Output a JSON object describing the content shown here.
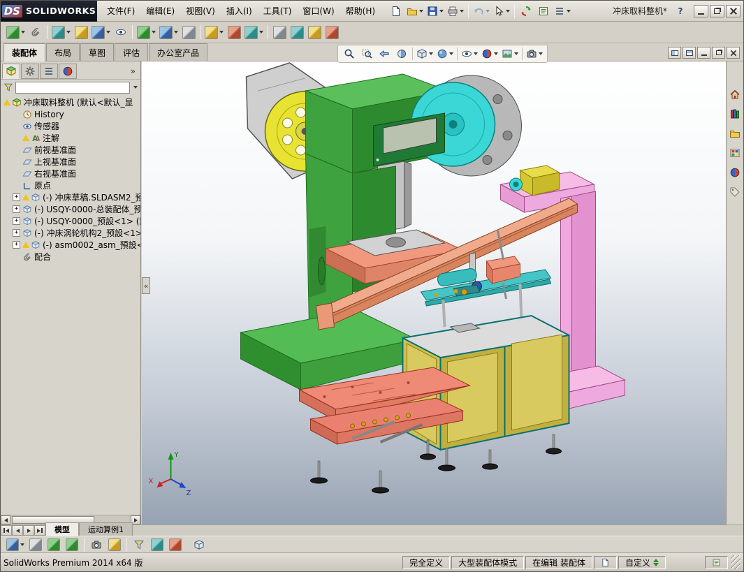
{
  "titlebar": {
    "brand_mark": "DS",
    "brand": "SOLIDWORKS",
    "doc_title": "冲床取料整机*",
    "help_label": "?",
    "menus": [
      "文件(F)",
      "编辑(E)",
      "视图(V)",
      "插入(I)",
      "工具(T)",
      "窗口(W)",
      "帮助(H)"
    ]
  },
  "toolbar_main": {
    "items": [
      "new-document",
      "open-document",
      "save-document",
      "print-document",
      "undo",
      "select-arrow",
      "rebuild",
      "file-properties",
      "options-list"
    ]
  },
  "toolbar_assembly": {
    "items": [
      "insert-components",
      "mate",
      "linear-component-pattern",
      "smart-fasteners",
      "move-component",
      "show-hidden-components",
      "assembly-features",
      "reference-geometry",
      "new-motion-study",
      "bill-of-materials",
      "exploded-view",
      "explode-line-sketch",
      "interference-detection",
      "clearance-verification",
      "hole-alignment",
      "isolate-components"
    ]
  },
  "command_tabs": {
    "items": [
      "装配体",
      "布局",
      "草图",
      "评估",
      "办公室产品"
    ],
    "active": "装配体"
  },
  "panel_tabs": {
    "items": [
      "featuremanager",
      "propertymanager",
      "configurationmanager",
      "displaymanager"
    ],
    "more_label": "»"
  },
  "feature_panel": {
    "filter_value": "",
    "collapse_label": "«",
    "tree": [
      {
        "label": "冲床取料整机 (默认<默认_显",
        "icon": "assembly",
        "warning": true
      },
      {
        "label": "History",
        "icon": "history"
      },
      {
        "label": "传感器",
        "icon": "sensors"
      },
      {
        "label": "注解",
        "icon": "annotations",
        "warning": true
      },
      {
        "label": "前视基准面",
        "icon": "plane"
      },
      {
        "label": "上视基准面",
        "icon": "plane"
      },
      {
        "label": "右视基准面",
        "icon": "plane"
      },
      {
        "label": "原点",
        "icon": "origin"
      },
      {
        "label": "(-) 冲床草稿.SLDASM2_预",
        "icon": "component",
        "warning": true,
        "expandable": true
      },
      {
        "label": "(-) USQY-0000-总装配体_预",
        "icon": "component",
        "expandable": true
      },
      {
        "label": "(-) USQY-0000_预設<1> (默",
        "icon": "component",
        "expandable": true
      },
      {
        "label": "(-) 冲床涡轮机构2_预設<1>",
        "icon": "component",
        "expandable": true
      },
      {
        "label": "(-) asm0002_asm_預設<1",
        "icon": "component",
        "warning": true,
        "expandable": true
      },
      {
        "label": "配合",
        "icon": "mates"
      }
    ]
  },
  "headsup": {
    "items": [
      "zoom-to-fit",
      "zoom-to-area",
      "previous-view",
      "section-view",
      "view-orientation",
      "display-style",
      "hide-show-items",
      "edit-appearance",
      "apply-scene",
      "view-settings"
    ]
  },
  "doc_window": {
    "items": [
      "pane-split-horizontal",
      "pane-split-vertical",
      "doc-minimize",
      "doc-restore",
      "doc-close"
    ]
  },
  "taskpane": {
    "items": [
      "solidworks-resources",
      "design-library",
      "file-explorer",
      "view-palette",
      "appearances",
      "custom-properties"
    ]
  },
  "viewport": {
    "triad": {
      "x": "X",
      "y": "Y",
      "z": "Z"
    }
  },
  "bottom_tabs": {
    "items": [
      "模型",
      "运动算例1"
    ],
    "active": "模型"
  },
  "motion_toolbar": {
    "items": [
      "motion-study-type",
      "calculate",
      "play-from-start",
      "play-controls",
      "save-animation",
      "animation-wizard",
      "filter-animated",
      "filter-driving",
      "filter-results"
    ]
  },
  "statusbar": {
    "left": "SolidWorks Premium 2014 x64 版",
    "fully_defined": "完全定义",
    "large_assembly_mode": "大型装配体模式",
    "editing": "在编辑 装配体",
    "custom": "自定义"
  },
  "colors": {
    "press_green": "#3ea23e",
    "flange_cyan": "#3bd6d6",
    "frame_pink": "#f0a8de",
    "table_salmon": "#ef8a76",
    "flywheel_yellow": "#e8e332"
  }
}
